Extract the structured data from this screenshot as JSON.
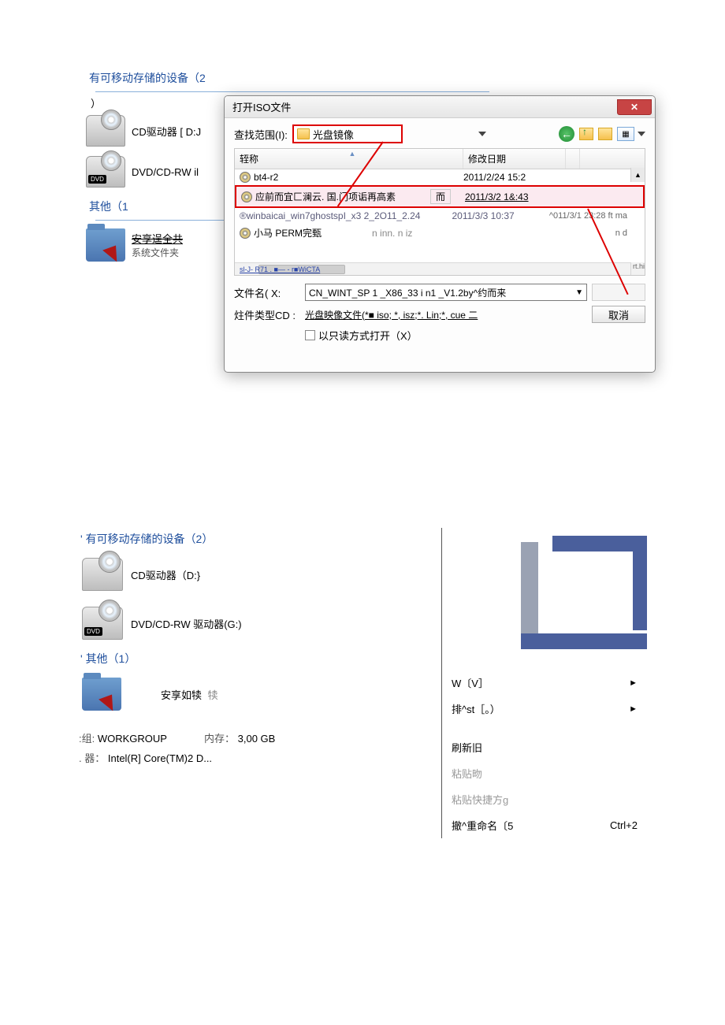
{
  "explorer": {
    "section_removable": "有可移动存储的设备（2",
    "section_removable_cont": "）",
    "section_other": "其他（1",
    "cd_label": "CD驱动器 [ D:J",
    "dvd_label": "DVD/CD-RW il",
    "share_item": "安享逞全共",
    "share_sub": "系统文件夹"
  },
  "dialog": {
    "title": "打开ISO文件",
    "lookin_label": "查找范围(I):",
    "lookin_value": "光盘镜像",
    "header_name": "轾称",
    "header_modified": "修改日期",
    "rows": [
      {
        "name": "bt4-r2",
        "date": "2011/2/24 15:2"
      },
      {
        "name": "应前而宜匚澜云. 国.门项诟再高素",
        "mid": "而",
        "date": "2011/3/2 1&:43"
      },
      {
        "name": "®winbaicai_win7ghostspI_x3 2_2O11_2.24",
        "date": "2011/3/3 10:37",
        "extra": "^011/3/1 23:28 ft ma"
      },
      {
        "name": "小马  PERM完甄",
        "mid": "n inn. n iz",
        "date": "",
        "extra": "n d"
      }
    ],
    "hscroll_link": "sl-J- R71 . ■— - r■WiCTA",
    "corner": "rt.hi",
    "filename_label": "文件名( X:",
    "filename_value": "CN_WINT_SP 1 _X86_33 i n1 _V1.2by^约而来",
    "filetype_label": "炷件类型CD :",
    "filetype_value": "光盘映像文件(*■ iso; *, isz;*. Lin;*, cue 二",
    "cancel": "取消",
    "readonly": "以只读方式打开（X）"
  },
  "bottom_left": {
    "section_removable": "' 有可移动存储的设备（2）",
    "cd_label": "CD驱动器（D:}",
    "dvd_label": "DVD/CD-RW 驱动器(G:)",
    "section_other": "' 其他（1）",
    "share_item": "安享如犊",
    "share_tail": "犊",
    "group_label": ":组:",
    "group_value": "WORKGROUP",
    "mem_label": "内存：",
    "mem_value": "3,00 GB",
    "cpu_label": ". 器：",
    "cpu_value": "Intel(R] Core(TM)2 D..."
  },
  "context_menu": {
    "items": [
      {
        "label": "W〔V］",
        "arrow": "►",
        "disabled": false
      },
      {
        "label": "排^st［。）",
        "arrow": "►",
        "disabled": false
      },
      {
        "label": "刷新旧",
        "arrow": "",
        "disabled": false
      },
      {
        "label": "粘贴昒",
        "arrow": "",
        "disabled": true
      },
      {
        "label": "粘贴快捷方g",
        "arrow": "",
        "disabled": true
      },
      {
        "label": "撤^重命名〔5",
        "shortcut": "Ctrl+2",
        "disabled": false
      }
    ]
  }
}
